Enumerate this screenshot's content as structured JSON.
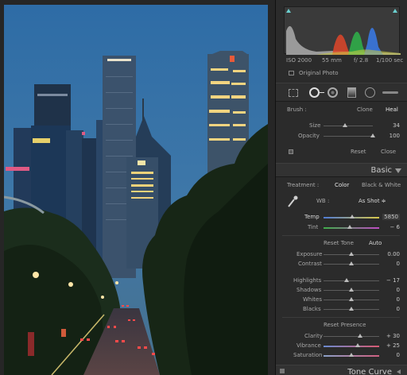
{
  "photo": {
    "description": "Singapore skyline at dusk with traffic"
  },
  "histogram": {
    "iso": "ISO 2000",
    "focal": "55 mm",
    "aperture": "f/ 2.8",
    "shutter": "1/100 sec",
    "original_photo_label": "Original Photo"
  },
  "tools": [
    "crop-overlay-icon",
    "spot-removal-icon",
    "red-eye-icon",
    "graduated-filter-icon",
    "radial-filter-icon",
    "adjustment-brush-icon"
  ],
  "spot": {
    "brush_label": "Brush :",
    "clone_label": "Clone",
    "heal_label": "Heal",
    "size_label": "Size",
    "size_value": "34",
    "size_level": 0.43,
    "opacity_label": "Opacity",
    "opacity_value": "100",
    "opacity_level": 1.0,
    "reset_label": "Reset",
    "close_label": "Close"
  },
  "basic": {
    "title": "Basic",
    "treatment_label": "Treatment :",
    "color_label": "Color",
    "bw_label": "Black & White",
    "wb_label": "WB :",
    "wb_value": "As Shot ≑",
    "temp_label": "Temp",
    "temp_value": "5850",
    "temp_level": 0.51,
    "tint_label": "Tint",
    "tint_value": "− 6",
    "tint_level": 0.47,
    "reset_tone_label": "Reset Tone",
    "auto_label": "Auto",
    "exposure_label": "Exposure",
    "exposure_value": "0.00",
    "exposure_level": 0.5,
    "contrast_label": "Contrast",
    "contrast_value": "0",
    "contrast_level": 0.5,
    "highlights_label": "Highlights",
    "highlights_value": "− 17",
    "highlights_level": 0.41,
    "shadows_label": "Shadows",
    "shadows_value": "0",
    "shadows_level": 0.5,
    "whites_label": "Whites",
    "whites_value": "0",
    "whites_level": 0.5,
    "blacks_label": "Blacks",
    "blacks_value": "0",
    "blacks_level": 0.5,
    "reset_presence_label": "Reset Presence",
    "clarity_label": "Clarity",
    "clarity_value": "+ 30",
    "clarity_level": 0.65,
    "vibrance_label": "Vibrance",
    "vibrance_value": "+ 25",
    "vibrance_level": 0.62,
    "saturation_label": "Saturation",
    "saturation_value": "0",
    "saturation_level": 0.5
  },
  "tone_curve": {
    "title": "Tone Curve"
  },
  "colors": {
    "temp_gradient": [
      "#4f7bd6",
      "#d8c84a"
    ],
    "tint_gradient": [
      "#3fae4a",
      "#c04cc4"
    ],
    "vibrance_gradient": [
      "#6a8ad0",
      "#d85a72"
    ],
    "saturation_gradient": [
      "#8aa0c8",
      "#d06080"
    ]
  }
}
